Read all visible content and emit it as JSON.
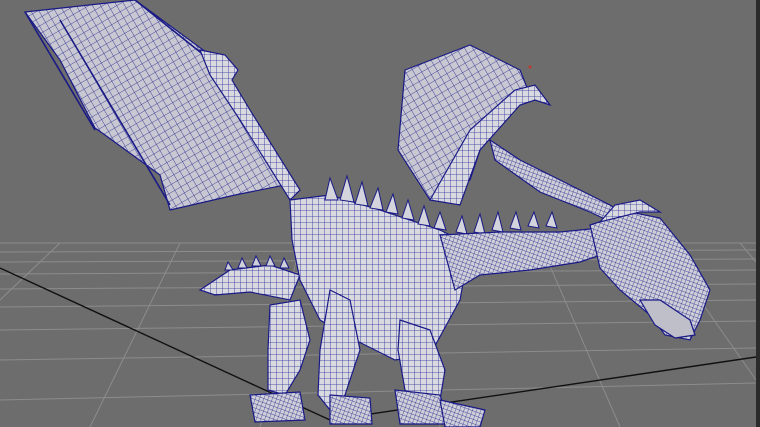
{
  "viewport": {
    "background": "#6d6d6d",
    "grid_color": "#8a8a8a",
    "axis_color": "#111111",
    "wire_color": "#1f1f8f",
    "surface_color": "#d8d8de"
  },
  "scene": {
    "object": "dragon-wireframe-mesh",
    "shading": "smooth-shade-with-wireframe"
  }
}
